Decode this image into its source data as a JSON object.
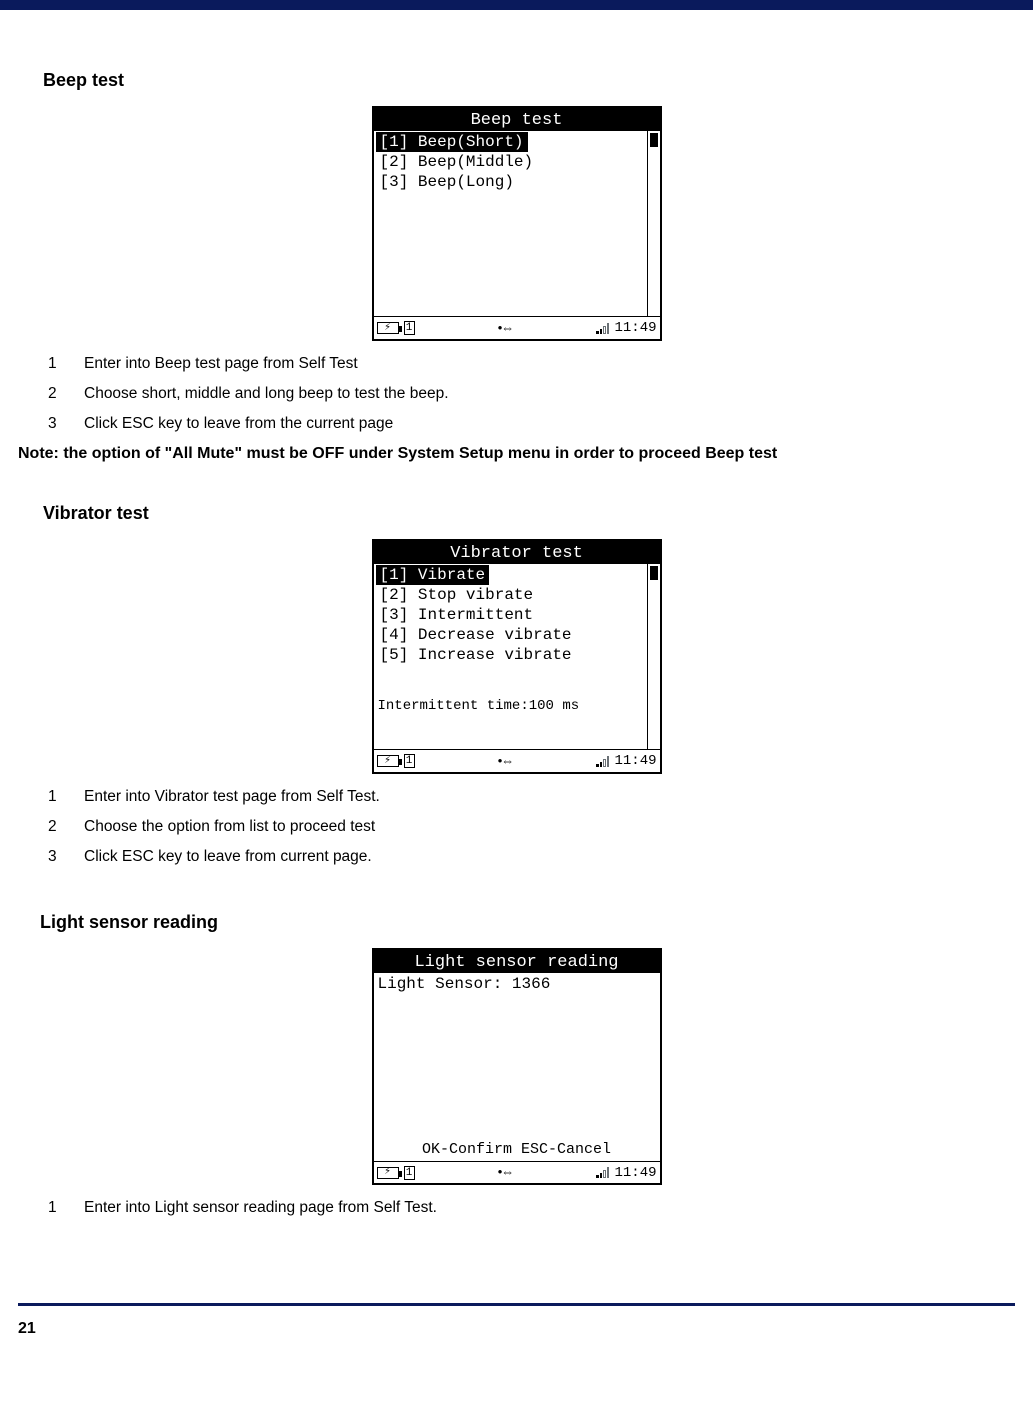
{
  "sections": {
    "beep": {
      "heading": "Beep test",
      "screen_title": "Beep test",
      "items": [
        "[1] Beep(Short)",
        "[2] Beep(Middle)",
        "[3] Beep(Long)"
      ],
      "time": "11:49",
      "steps": [
        "Enter into Beep test page from Self Test",
        "Choose short, middle and long beep to test the beep.",
        "Click ESC key to leave from the current page"
      ]
    },
    "note": "Note: the option of \"All Mute\" must be OFF under System Setup menu in order to proceed Beep test",
    "vibrator": {
      "heading": "Vibrator test",
      "screen_title": "Vibrator test",
      "items": [
        "[1] Vibrate",
        "[2] Stop vibrate",
        "[3] Intermittent",
        "[4] Decrease vibrate",
        "[5] Increase vibrate"
      ],
      "extra": "Intermittent time:100 ms",
      "time": "11:49",
      "steps": [
        "Enter into Vibrator test page from Self Test.",
        "Choose the option from list to proceed test",
        "Click ESC key to leave from current page."
      ]
    },
    "light": {
      "heading": "Light sensor reading",
      "screen_title": "Light sensor reading",
      "body": "Light Sensor: 1366",
      "hint": "OK-Confirm  ESC-Cancel",
      "time": "11:49",
      "steps": [
        "Enter into Light sensor reading page from Self Test."
      ]
    }
  },
  "status_index": "1",
  "page_number": "21"
}
